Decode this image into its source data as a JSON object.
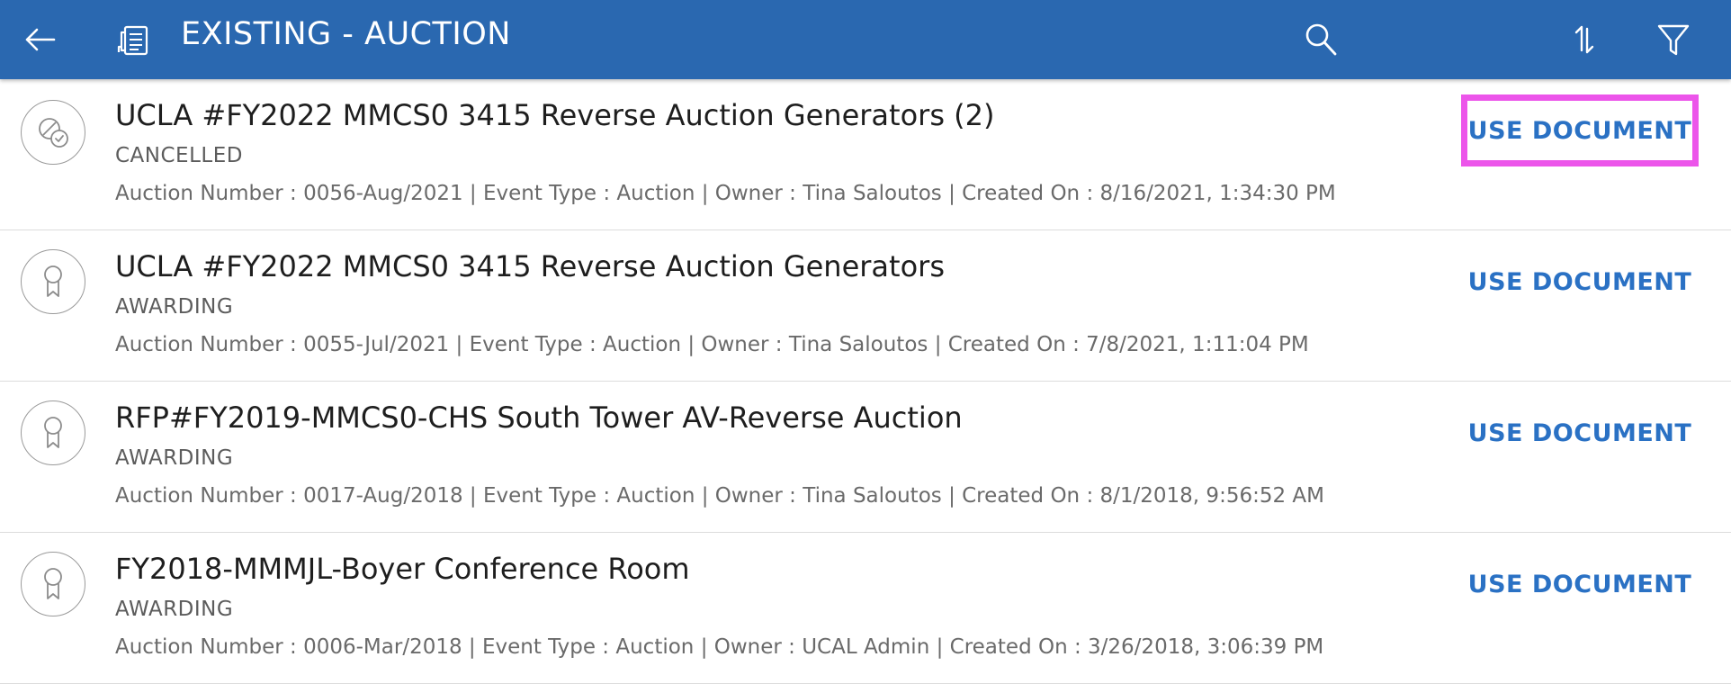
{
  "header": {
    "title": "EXISTING - AUCTION",
    "back_icon": "arrow-left-icon",
    "doc_icon": "document-list-icon",
    "search_icon": "search-icon",
    "sort_icon": "sort-icon",
    "filter_icon": "filter-icon"
  },
  "colors": {
    "header_bg": "#2a68b0",
    "action_text": "#2a71c4",
    "highlight_border": "#ec55ea"
  },
  "items": [
    {
      "title": "UCLA #FY2022 MMCS0 3415 Reverse Auction Generators (2)",
      "status": "CANCELLED",
      "status_icon": "cancelled-badge-icon",
      "meta": "Auction Number : 0056-Aug/2021 | Event Type : Auction | Owner : Tina Saloutos | Created On : 8/16/2021, 1:34:30 PM",
      "action_label": "USE DOCUMENT"
    },
    {
      "title": "UCLA #FY2022 MMCS0 3415 Reverse Auction Generators",
      "status": "AWARDING",
      "status_icon": "award-ribbon-icon",
      "meta": "Auction Number : 0055-Jul/2021 | Event Type : Auction | Owner : Tina Saloutos | Created On : 7/8/2021, 1:11:04 PM",
      "action_label": "USE DOCUMENT"
    },
    {
      "title": "RFP#FY2019-MMCS0-CHS South Tower AV-Reverse Auction",
      "status": "AWARDING",
      "status_icon": "award-ribbon-icon",
      "meta": "Auction Number : 0017-Aug/2018 | Event Type : Auction | Owner : Tina Saloutos | Created On : 8/1/2018, 9:56:52 AM",
      "action_label": "USE DOCUMENT"
    },
    {
      "title": "FY2018-MMMJL-Boyer Conference Room",
      "status": "AWARDING",
      "status_icon": "award-ribbon-icon",
      "meta": "Auction Number : 0006-Mar/2018 | Event Type : Auction | Owner : UCAL Admin | Created On : 3/26/2018, 3:06:39 PM",
      "action_label": "USE DOCUMENT"
    }
  ]
}
